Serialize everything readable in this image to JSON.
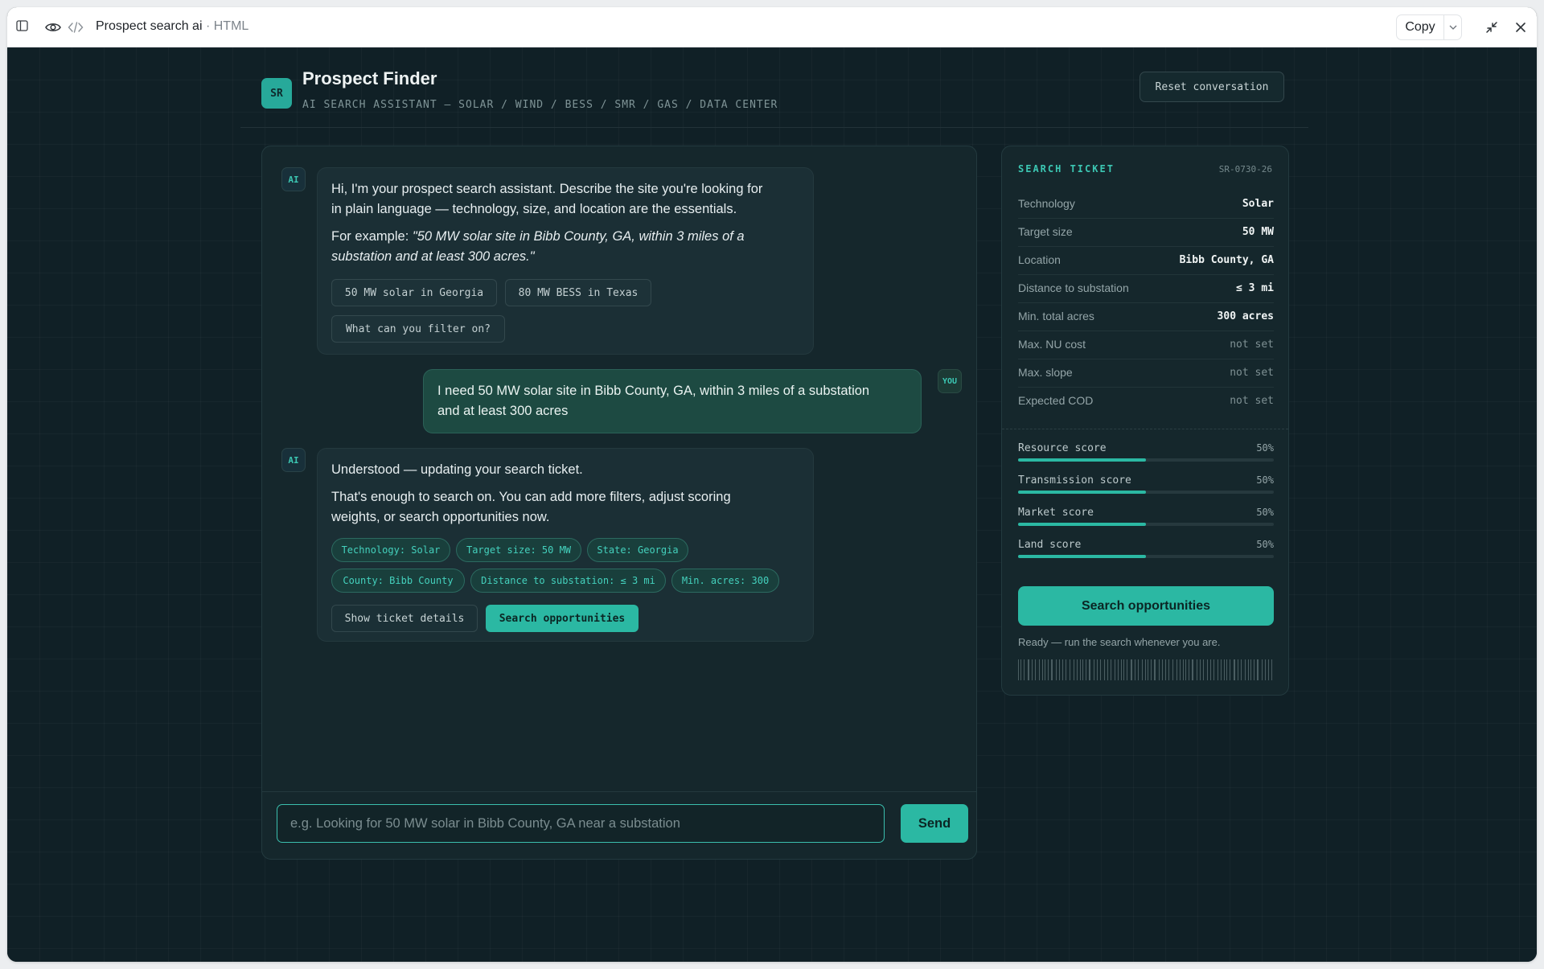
{
  "window": {
    "title": "Prospect search ai",
    "format": "HTML",
    "copy_label": "Copy"
  },
  "app": {
    "logo": "SR",
    "title": "Prospect Finder",
    "subtitle": "AI SEARCH ASSISTANT — SOLAR / WIND / BESS / SMR / GAS / DATA CENTER",
    "reset_label": "Reset conversation"
  },
  "chat": {
    "ai_label": "AI",
    "you_label": "YOU",
    "msg1": {
      "line1": "Hi, I'm your prospect search assistant. Describe the site you're looking for",
      "line2": "in plain language — technology, size, and location are the essentials.",
      "example_prefix": "For example: ",
      "example_line1": "\"50 MW solar site in Bibb County, GA, within 3 miles of a",
      "example_line2": "substation and at least 300 acres.\"",
      "suggestions": [
        "50 MW solar in Georgia",
        "80 MW BESS in Texas",
        "What can you filter on?"
      ]
    },
    "msg2": {
      "line1": "I need 50 MW solar site in Bibb County, GA, within 3 miles of a substation",
      "line2": "and at least 300 acres"
    },
    "msg3": {
      "line1": "Understood — updating your search ticket.",
      "line2": "That's enough to search on. You can add more filters, adjust scoring",
      "line3": "weights, or search opportunities now.",
      "pills": [
        "Technology: Solar",
        "Target size: 50 MW",
        "State: Georgia",
        "County: Bibb County",
        "Distance to substation: ≤ 3 mi",
        "Min. acres: 300"
      ],
      "details_label": "Show ticket details",
      "search_label": "Search opportunities"
    },
    "input_placeholder": "e.g. Looking for 50 MW solar in Bibb County, GA near a substation",
    "input_value": "",
    "send_label": "Send"
  },
  "ticket": {
    "heading": "SEARCH TICKET",
    "id": "SR-0730-26",
    "rows": [
      {
        "label": "Technology",
        "value": "Solar"
      },
      {
        "label": "Target size",
        "value": "50 MW"
      },
      {
        "label": "Location",
        "value": "Bibb County, GA"
      },
      {
        "label": "Distance to substation",
        "value": "≤ 3 mi"
      },
      {
        "label": "Min. total acres",
        "value": "300 acres"
      },
      {
        "label": "Max. NU cost",
        "value": "not set"
      },
      {
        "label": "Max. slope",
        "value": "not set"
      },
      {
        "label": "Expected COD",
        "value": "not set"
      }
    ],
    "scores": [
      {
        "label": "Resource score",
        "value": "50%",
        "fraction": 0.5
      },
      {
        "label": "Transmission score",
        "value": "50%",
        "fraction": 0.5
      },
      {
        "label": "Market score",
        "value": "50%",
        "fraction": 0.5
      },
      {
        "label": "Land score",
        "value": "50%",
        "fraction": 0.5
      }
    ],
    "search_label": "Search opportunities",
    "status": "Ready — run the search whenever you are."
  },
  "colors": {
    "accent": "#2bb8a3",
    "background": "#102026",
    "panel": "#15272c"
  }
}
